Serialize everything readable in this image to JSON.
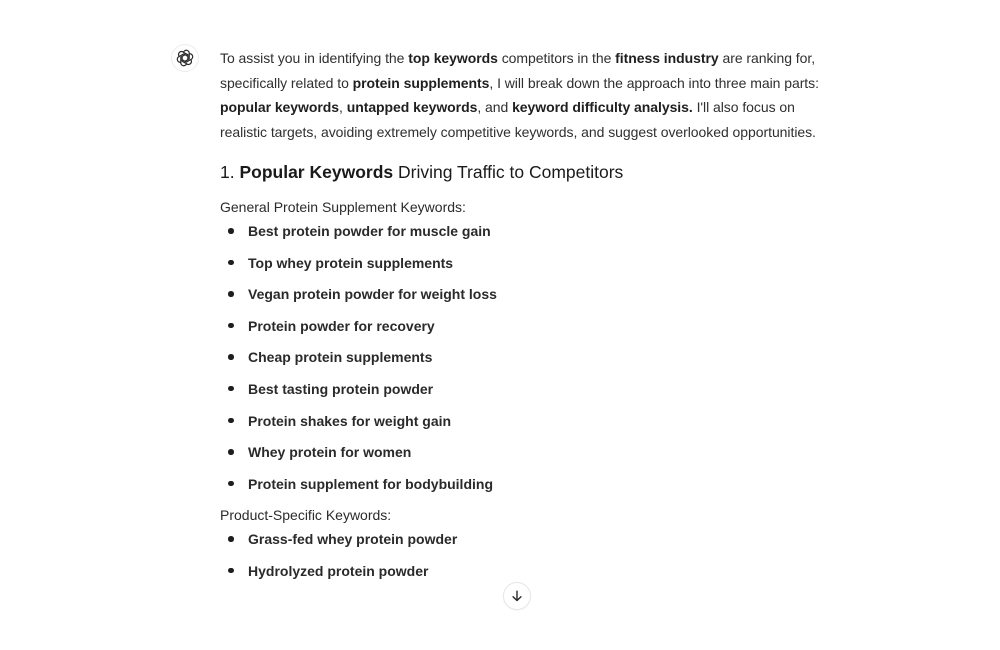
{
  "assistant": {
    "avatar_icon": "openai-logo-icon"
  },
  "message": {
    "intro": [
      {
        "text": "To assist you in identifying the ",
        "bold": false
      },
      {
        "text": "top keywords",
        "bold": true
      },
      {
        "text": " competitors in the ",
        "bold": false
      },
      {
        "text": "fitness industry",
        "bold": true
      },
      {
        "text": " are ranking for, specifically related to ",
        "bold": false
      },
      {
        "text": "protein supplements",
        "bold": true
      },
      {
        "text": ", I will break down the approach into three main parts: ",
        "bold": false
      },
      {
        "text": "popular keywords",
        "bold": true
      },
      {
        "text": ", ",
        "bold": false
      },
      {
        "text": "untapped keywords",
        "bold": true
      },
      {
        "text": ", and ",
        "bold": false
      },
      {
        "text": "keyword difficulty analysis.",
        "bold": true
      },
      {
        "text": " I'll also focus on realistic targets, avoiding extremely competitive keywords, and suggest overlooked opportunities.",
        "bold": false
      }
    ],
    "section1": {
      "number": "1. ",
      "title_bold": "Popular Keywords",
      "title_rest": " Driving Traffic to Competitors"
    },
    "general": {
      "label": "General Protein Supplement Keywords:",
      "items": [
        "Best protein powder for muscle gain",
        "Top whey protein supplements",
        "Vegan protein powder for weight loss",
        "Protein powder for recovery",
        "Cheap protein supplements",
        "Best tasting protein powder",
        "Protein shakes for weight gain",
        "Whey protein for women",
        "Protein supplement for bodybuilding"
      ]
    },
    "product_specific": {
      "label": "Product-Specific Keywords:",
      "items": [
        "Grass-fed whey protein powder",
        "Hydrolyzed protein powder"
      ]
    }
  },
  "controls": {
    "scroll_down_icon": "arrow-down-icon"
  }
}
